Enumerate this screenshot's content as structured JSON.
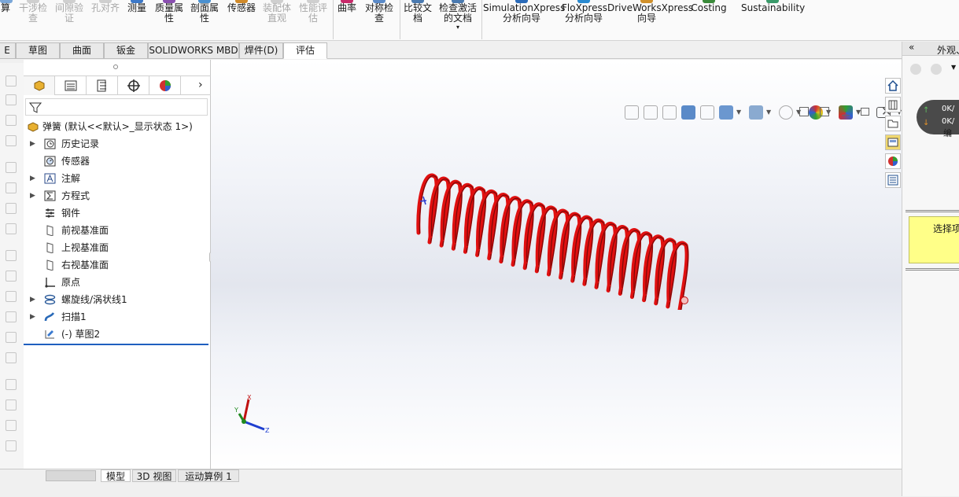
{
  "ribbon": {
    "partial_left": "算",
    "buttons": [
      {
        "id": "interference",
        "label": "干涉检\n查",
        "disabled": true
      },
      {
        "id": "clearance",
        "label": "间隙验\n证",
        "disabled": true
      },
      {
        "id": "hole-align",
        "label": "孔对齐",
        "disabled": true
      },
      {
        "id": "measure",
        "label": "测量",
        "disabled": false
      },
      {
        "id": "mass-props",
        "label": "质量属\n性",
        "disabled": false
      },
      {
        "id": "section-props",
        "label": "剖面属\n性",
        "disabled": false
      },
      {
        "id": "sensor",
        "label": "传感器",
        "disabled": false
      },
      {
        "id": "assembly-visual",
        "label": "装配体\n直观",
        "disabled": true
      },
      {
        "id": "perf-eval",
        "label": "性能评\n估",
        "disabled": true
      },
      {
        "id": "curvature",
        "label": "曲率",
        "disabled": false
      },
      {
        "id": "symmetry-check",
        "label": "对称检\n查",
        "disabled": false
      },
      {
        "id": "compare-docs",
        "label": "比较文\n档",
        "disabled": false
      },
      {
        "id": "check-active",
        "label": "检查激活\n的文档",
        "disabled": false
      },
      {
        "id": "simxpress",
        "label": "SimulationXpress\n分析向导",
        "disabled": false
      },
      {
        "id": "floxpress",
        "label": "FloXpress\n分析向导",
        "disabled": false
      },
      {
        "id": "driveworks",
        "label": "DriveWorksXpress\n向导",
        "disabled": false
      },
      {
        "id": "costing",
        "label": "Costing",
        "disabled": false
      },
      {
        "id": "sustainability",
        "label": "Sustainability",
        "disabled": false
      }
    ]
  },
  "tabs": [
    {
      "label": "E",
      "active": false
    },
    {
      "label": "草图",
      "active": false
    },
    {
      "label": "曲面",
      "active": false
    },
    {
      "label": "钣金",
      "active": false
    },
    {
      "label": "SOLIDWORKS MBD",
      "active": false
    },
    {
      "label": "焊件(D)",
      "active": false
    },
    {
      "label": "评估",
      "active": true
    }
  ],
  "feature_tree": {
    "root": "弹簧  (默认<<默认>_显示状态 1>)",
    "nodes": [
      {
        "label": "历史记录",
        "expandable": true,
        "icon": "history-icon"
      },
      {
        "label": "传感器",
        "expandable": false,
        "icon": "sensor-icon"
      },
      {
        "label": "注解",
        "expandable": true,
        "icon": "annotation-icon"
      },
      {
        "label": "方程式",
        "expandable": true,
        "icon": "equation-icon"
      },
      {
        "label": "钢件",
        "expandable": false,
        "icon": "material-icon"
      },
      {
        "label": "前视基准面",
        "expandable": false,
        "icon": "plane-icon"
      },
      {
        "label": "上视基准面",
        "expandable": false,
        "icon": "plane-icon"
      },
      {
        "label": "右视基准面",
        "expandable": false,
        "icon": "plane-icon"
      },
      {
        "label": "原点",
        "expandable": false,
        "icon": "origin-icon"
      },
      {
        "label": "螺旋线/涡状线1",
        "expandable": true,
        "icon": "helix-icon"
      },
      {
        "label": "扫描1",
        "expandable": true,
        "icon": "sweep-icon"
      },
      {
        "label": "(-) 草图2",
        "expandable": false,
        "icon": "sketch-icon"
      }
    ]
  },
  "bottom_tabs": [
    {
      "label": "模型",
      "active": true
    },
    {
      "label": "3D 视图",
      "active": false
    },
    {
      "label": "运动算例 1",
      "active": false
    }
  ],
  "triad": {
    "x": "X",
    "y": "Y",
    "z": "Z"
  },
  "right_panel": {
    "title": "外观、",
    "net_up": "0K/",
    "net_down": "0K/",
    "partial_label": "编",
    "select_hint": "选择项"
  },
  "colors": {
    "spring": "#e01010",
    "accent": "#1f5fbf"
  }
}
